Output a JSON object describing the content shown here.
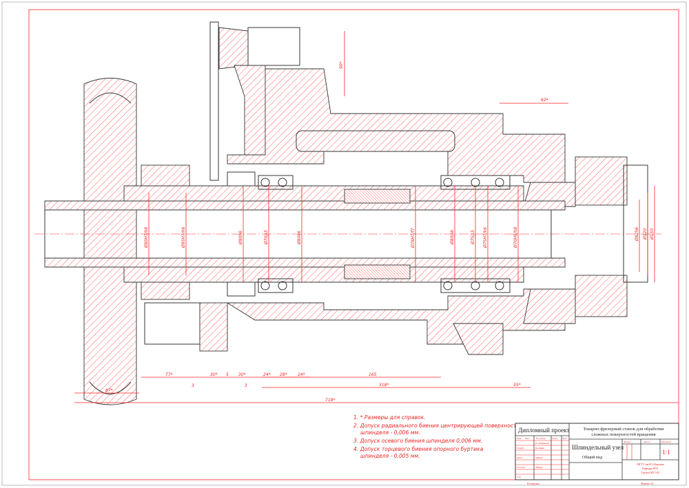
{
  "notes": [
    "1. * Размеры для справок.",
    "2. Допуск радиального биения центрирующей поверхности",
    "шпинделя - 0,006 мм.",
    "3. Допуск осевого биения шпинделя 0,006 мм.",
    "4. Допуск торцевого биения опорного буртика",
    "шпинделя - 0,005 мм."
  ],
  "dimensions": {
    "bottom": [
      "77*",
      "30*",
      "5",
      "30*",
      "24*",
      "28*",
      "24*",
      "165",
      "318*",
      "35*",
      "87*",
      "718*"
    ],
    "top": [
      "62*",
      "90*"
    ],
    "leaders": [
      "3",
      "3"
    ],
    "diameters": [
      "Ø80H7/h6",
      "Ø95H7/h6",
      "Ø90h6",
      "Ø70js5",
      "Ø80k6",
      "Ø78H7/f7",
      "Ø80js6",
      "Ø75js5",
      "Ø75H7/k6",
      "Ø70H8/h8",
      "Ø82h6",
      "Ø120",
      "Ø150"
    ]
  },
  "title_block": {
    "project": "Дипломный проект",
    "machine": [
      "Токарно-фрезерный станок для обработки",
      "сложных поверхностей вращения"
    ],
    "assembly": "Шпиндельный узел",
    "view": "Общий вид",
    "scale": "1:1",
    "col_headers": [
      "Изм.",
      "Лист",
      "№ докум.",
      "Подп.",
      "Дата"
    ],
    "roles": [
      "Разраб.",
      "Пров.",
      "Н.контр.",
      "Утв."
    ],
    "names": [
      "И. инкремент",
      "Калинин",
      "Зайцев",
      "Зайцев"
    ],
    "right_headers": [
      "Литера",
      "Масса",
      "Масштаб"
    ],
    "org": [
      "МГТУ им.Н.Э.Баумана",
      "Кафедра МТ1",
      "Группа МТ1-82"
    ],
    "copied": "Копировал",
    "format": "Формат А1"
  },
  "colors": {
    "line": "#ff2222",
    "outline": "#333333"
  }
}
